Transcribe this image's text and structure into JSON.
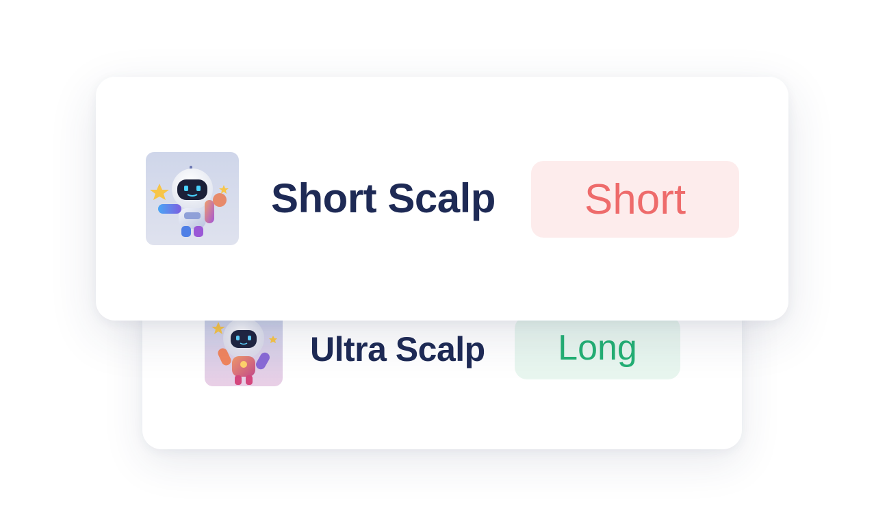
{
  "bots": [
    {
      "name": "Short Scalp",
      "direction": "Short",
      "direction_color": "#ee6b6b",
      "direction_bg": "#fdecec",
      "avatar_icon": "robot-avatar-icon"
    },
    {
      "name": "Ultra Scalp",
      "direction": "Long",
      "direction_color": "#23b074",
      "direction_bg": "#e8f6ef",
      "avatar_icon": "robot-avatar-icon"
    }
  ],
  "colors": {
    "name_text": "#1e2a55"
  }
}
